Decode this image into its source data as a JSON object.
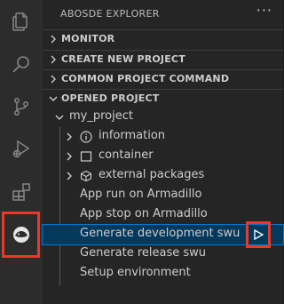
{
  "activity_bar": {
    "items": [
      {
        "name": "explorer-files-icon"
      },
      {
        "name": "search-icon"
      },
      {
        "name": "source-control-icon"
      },
      {
        "name": "run-debug-icon"
      },
      {
        "name": "extensions-icon"
      },
      {
        "name": "abosde-icon"
      }
    ],
    "highlight_color": "#e8382a"
  },
  "sidebar": {
    "title": "ABOSDE EXPLORER",
    "more_actions": "···",
    "sections": [
      {
        "label": "MONITOR",
        "expanded": false
      },
      {
        "label": "CREATE NEW PROJECT",
        "expanded": false
      },
      {
        "label": "COMMON PROJECT COMMAND",
        "expanded": false
      },
      {
        "label": "OPENED PROJECT",
        "expanded": true
      }
    ],
    "project": {
      "name": "my_project",
      "folders": [
        {
          "label": "information",
          "icon": "info-icon"
        },
        {
          "label": "container",
          "icon": "container-icon"
        },
        {
          "label": "external packages",
          "icon": "package-icon"
        }
      ],
      "commands": [
        {
          "label": "App run on Armadillo",
          "selected": false
        },
        {
          "label": "App stop on Armadillo",
          "selected": false
        },
        {
          "label": "Generate development swu",
          "selected": true
        },
        {
          "label": "Generate release swu",
          "selected": false
        },
        {
          "label": "Setup environment",
          "selected": false
        }
      ]
    }
  },
  "colors": {
    "selection_bg": "#04395e",
    "selection_border": "#0078d4",
    "highlight": "#e8382a"
  }
}
